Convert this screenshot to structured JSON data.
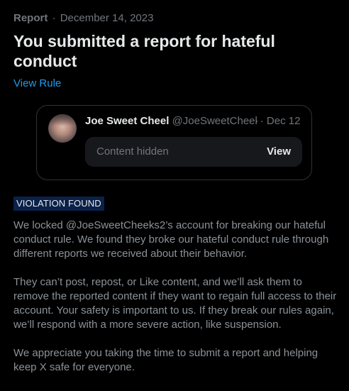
{
  "header": {
    "report_label": "Report",
    "separator": "·",
    "date": "December 14, 2023",
    "title": "You submitted a report for hateful conduct",
    "view_rule_label": "View Rule"
  },
  "quote": {
    "author_name": "Joe Sweet Cheel",
    "author_handle": "@JoeSweetCheeks2",
    "separator": "·",
    "date": "Dec 12",
    "hidden_text": "Content hidden",
    "view_label": "View"
  },
  "violation": {
    "badge": "VIOLATION FOUND",
    "paragraphs": [
      "We locked @JoeSweetCheeks2’s account for breaking our hateful conduct rule. We found they broke our hateful conduct rule through different reports we received about their behavior.",
      "They can’t post, repost, or Like content, and we’ll ask them to remove the reported content if they want to regain full access to their account. Your safety is important to us. If they break our rules again, we’ll respond with a more severe action, like suspension.",
      "We appreciate you taking the time to submit a report and helping keep X safe for everyone."
    ]
  },
  "colors": {
    "background": "#000000",
    "primary_text": "#e7e9ea",
    "secondary_text": "#71767b",
    "link": "#1d9bf0",
    "badge_bg": "#0a2149"
  }
}
